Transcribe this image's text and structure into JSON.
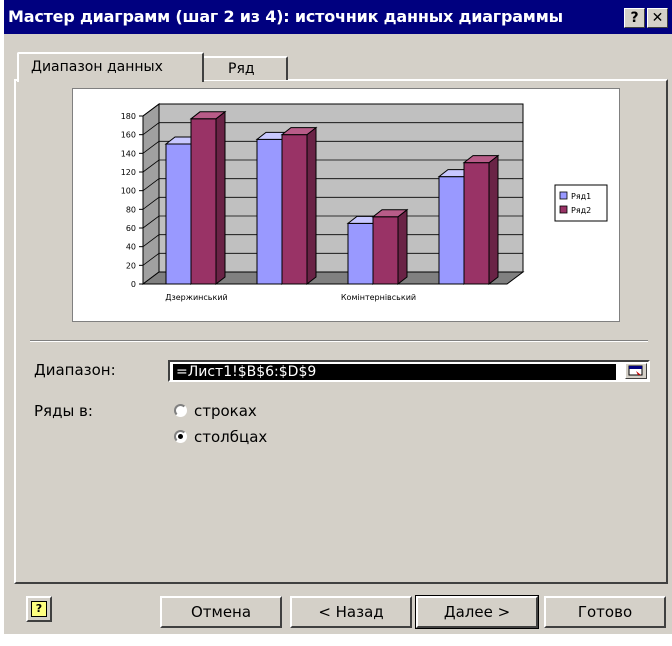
{
  "window": {
    "title": "Мастер диаграмм (шаг 2 из 4): источник данных диаграммы",
    "help_label": "?",
    "close_label": "✕"
  },
  "tabs": [
    {
      "label": "Диапазон данных",
      "active": true
    },
    {
      "label": "Ряд",
      "active": false
    }
  ],
  "form": {
    "range_label": "Диапазон:",
    "range_value": "=Лист1!$B$6:$D$9",
    "series_in_label": "Ряды в:",
    "options": [
      {
        "label": "строках",
        "selected": false
      },
      {
        "label": "столбцах",
        "selected": true
      }
    ]
  },
  "buttons": {
    "cancel": "Отмена",
    "back": "< Назад",
    "next": "Далее >",
    "finish": "Готово"
  },
  "colors": {
    "title_bg": "#00007f",
    "dialog_bg": "#d4d0c8",
    "series1": "#9999ff",
    "series2": "#993366"
  },
  "chart_data": {
    "type": "bar",
    "ylim": [
      0,
      180
    ],
    "yticks": [
      "180",
      "160",
      "140",
      "120",
      "100",
      "80",
      "60",
      "40",
      "20",
      "0"
    ],
    "categories": [
      "Дзержинський",
      "",
      "Комінтернівський",
      ""
    ],
    "series": [
      {
        "name": "Ряд1",
        "values": [
          150,
          155,
          65,
          115
        ]
      },
      {
        "name": "Ряд2",
        "values": [
          177,
          160,
          72,
          130
        ]
      }
    ],
    "grid": true,
    "legend": "right"
  }
}
